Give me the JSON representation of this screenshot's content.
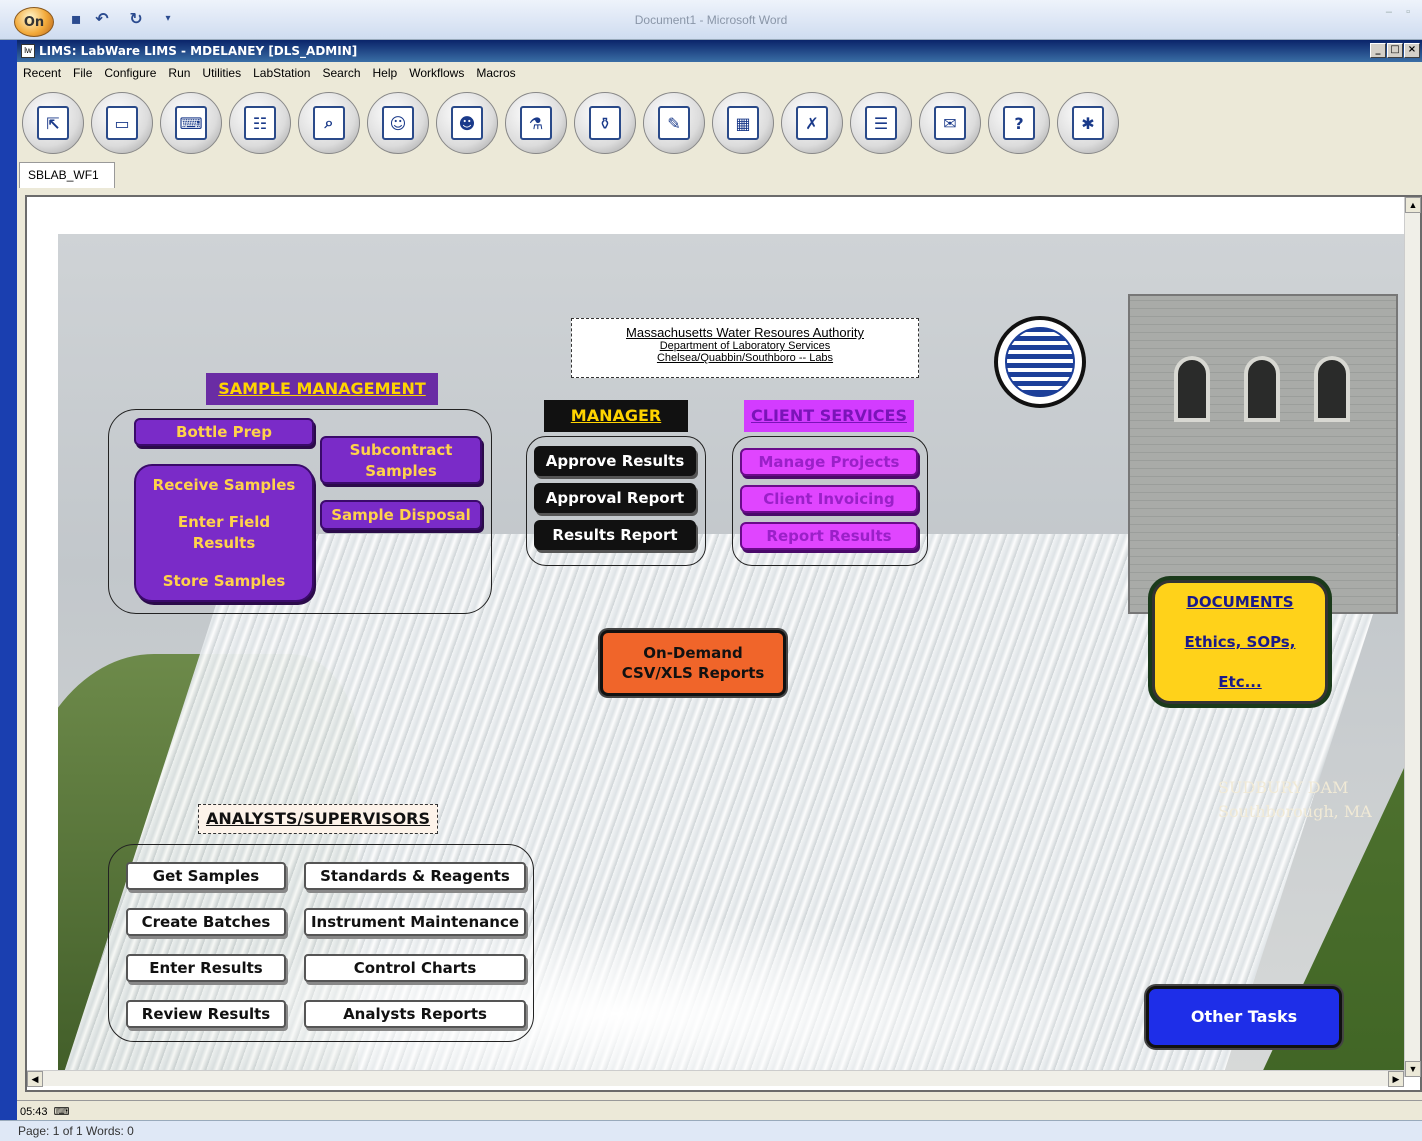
{
  "word": {
    "title": "Document1 - Microsoft Word",
    "orb_label": "On",
    "status_left": "Page: 1 of 1   Words: 0"
  },
  "lims": {
    "title": "LIMS: LabWare LIMS - MDELANEY [DLS_ADMIN]",
    "icon_label": "lw",
    "window_buttons": {
      "min": "_",
      "max": "□",
      "close": "×"
    },
    "menu": [
      "Recent",
      "File",
      "Configure",
      "Run",
      "Utilities",
      "LabStation",
      "Search",
      "Help",
      "Workflows",
      "Macros"
    ],
    "toolbar_icons": [
      "open-window-icon",
      "computer-icon",
      "laptop-icon",
      "calendar-list-icon",
      "report-search-icon",
      "people-icon",
      "user-search-icon",
      "flask-icon",
      "lab-bottles-icon",
      "checklist-icon",
      "grid-table-icon",
      "reject-sample-icon",
      "group-users-icon",
      "assign-user-icon",
      "help-icon",
      "settings-tools-icon"
    ],
    "tab_label": "SBLAB_WF1",
    "status_time": "05:43"
  },
  "org": {
    "line1": "Massachusetts Water Resoures Authority",
    "line2": "Department of Laboratory Services",
    "line3": "Chelsea/Quabbin/Southboro -- Labs"
  },
  "sample_management": {
    "header": "SAMPLE MANAGEMENT",
    "bottle_prep": "Bottle Prep",
    "subcontract": "Subcontract Samples",
    "disposal": "Sample Disposal",
    "receive": "Receive Samples",
    "field_results": "Enter Field Results",
    "store": "Store Samples"
  },
  "manager": {
    "header": "MANAGER",
    "approve": "Approve Results",
    "approval_report": "Approval Report",
    "results_report": "Results Report"
  },
  "client_services": {
    "header": "CLIENT SERVICES",
    "projects": "Manage Projects",
    "invoicing": "Client Invoicing",
    "report": "Report Results"
  },
  "on_demand": {
    "line1": "On-Demand",
    "line2": "CSV/XLS Reports"
  },
  "documents": {
    "title": "DOCUMENTS",
    "line1": "Ethics, SOPs,",
    "line2": "Etc..."
  },
  "dam": {
    "name": "SUDBURY DAM",
    "location": "Southborough, MA"
  },
  "analysts": {
    "header": "ANALYSTS/SUPERVISORS",
    "get_samples": "Get Samples",
    "create_batches": "Create Batches",
    "enter_results": "Enter Results",
    "review_results": "Review Results",
    "standards": "Standards & Reagents",
    "instrument": "Instrument Maintenance",
    "control_charts": "Control Charts",
    "analyst_reports": "Analysts Reports"
  },
  "other_tasks": "Other Tasks"
}
